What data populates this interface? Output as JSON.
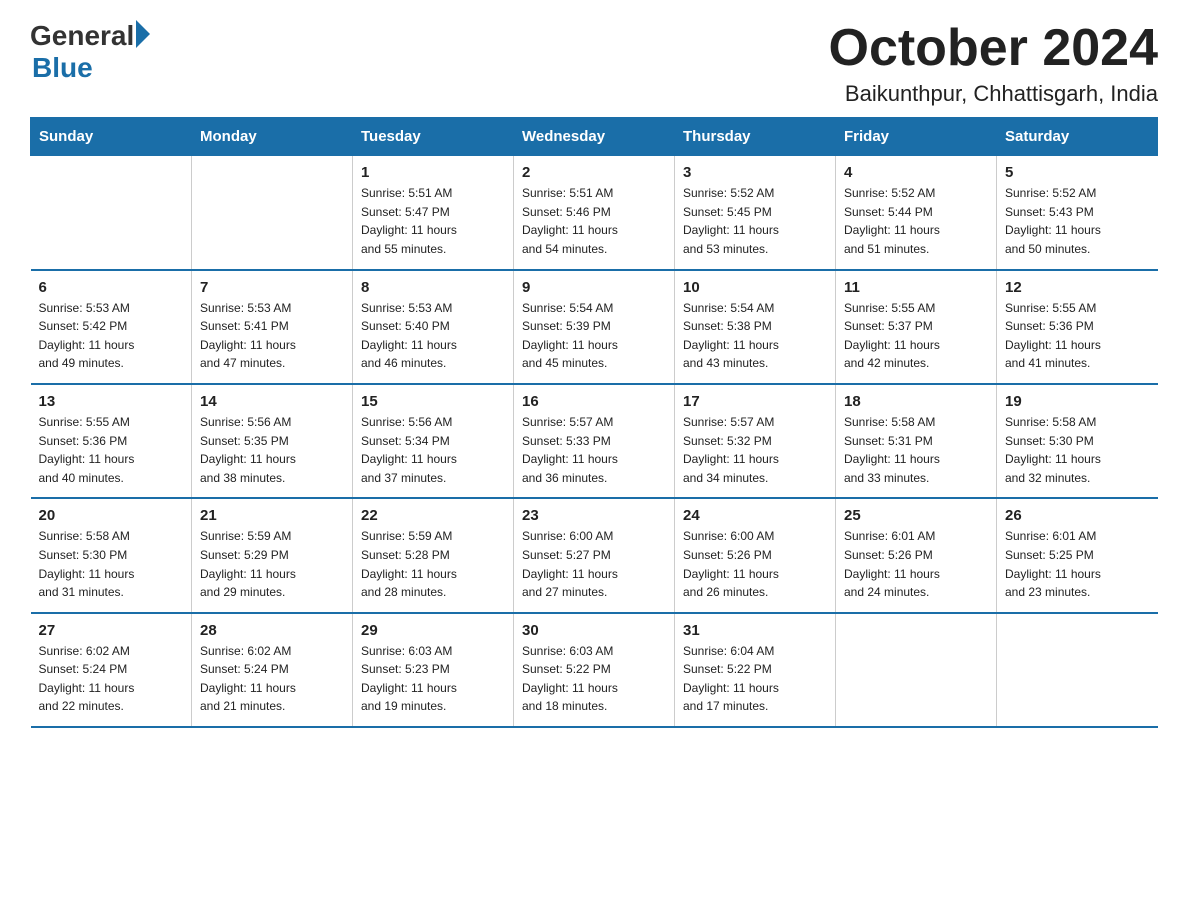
{
  "header": {
    "logo_general": "General",
    "logo_blue": "Blue",
    "title": "October 2024",
    "location": "Baikunthpur, Chhattisgarh, India"
  },
  "days_of_week": [
    "Sunday",
    "Monday",
    "Tuesday",
    "Wednesday",
    "Thursday",
    "Friday",
    "Saturday"
  ],
  "weeks": [
    [
      {
        "day": "",
        "info": ""
      },
      {
        "day": "",
        "info": ""
      },
      {
        "day": "1",
        "info": "Sunrise: 5:51 AM\nSunset: 5:47 PM\nDaylight: 11 hours\nand 55 minutes."
      },
      {
        "day": "2",
        "info": "Sunrise: 5:51 AM\nSunset: 5:46 PM\nDaylight: 11 hours\nand 54 minutes."
      },
      {
        "day": "3",
        "info": "Sunrise: 5:52 AM\nSunset: 5:45 PM\nDaylight: 11 hours\nand 53 minutes."
      },
      {
        "day": "4",
        "info": "Sunrise: 5:52 AM\nSunset: 5:44 PM\nDaylight: 11 hours\nand 51 minutes."
      },
      {
        "day": "5",
        "info": "Sunrise: 5:52 AM\nSunset: 5:43 PM\nDaylight: 11 hours\nand 50 minutes."
      }
    ],
    [
      {
        "day": "6",
        "info": "Sunrise: 5:53 AM\nSunset: 5:42 PM\nDaylight: 11 hours\nand 49 minutes."
      },
      {
        "day": "7",
        "info": "Sunrise: 5:53 AM\nSunset: 5:41 PM\nDaylight: 11 hours\nand 47 minutes."
      },
      {
        "day": "8",
        "info": "Sunrise: 5:53 AM\nSunset: 5:40 PM\nDaylight: 11 hours\nand 46 minutes."
      },
      {
        "day": "9",
        "info": "Sunrise: 5:54 AM\nSunset: 5:39 PM\nDaylight: 11 hours\nand 45 minutes."
      },
      {
        "day": "10",
        "info": "Sunrise: 5:54 AM\nSunset: 5:38 PM\nDaylight: 11 hours\nand 43 minutes."
      },
      {
        "day": "11",
        "info": "Sunrise: 5:55 AM\nSunset: 5:37 PM\nDaylight: 11 hours\nand 42 minutes."
      },
      {
        "day": "12",
        "info": "Sunrise: 5:55 AM\nSunset: 5:36 PM\nDaylight: 11 hours\nand 41 minutes."
      }
    ],
    [
      {
        "day": "13",
        "info": "Sunrise: 5:55 AM\nSunset: 5:36 PM\nDaylight: 11 hours\nand 40 minutes."
      },
      {
        "day": "14",
        "info": "Sunrise: 5:56 AM\nSunset: 5:35 PM\nDaylight: 11 hours\nand 38 minutes."
      },
      {
        "day": "15",
        "info": "Sunrise: 5:56 AM\nSunset: 5:34 PM\nDaylight: 11 hours\nand 37 minutes."
      },
      {
        "day": "16",
        "info": "Sunrise: 5:57 AM\nSunset: 5:33 PM\nDaylight: 11 hours\nand 36 minutes."
      },
      {
        "day": "17",
        "info": "Sunrise: 5:57 AM\nSunset: 5:32 PM\nDaylight: 11 hours\nand 34 minutes."
      },
      {
        "day": "18",
        "info": "Sunrise: 5:58 AM\nSunset: 5:31 PM\nDaylight: 11 hours\nand 33 minutes."
      },
      {
        "day": "19",
        "info": "Sunrise: 5:58 AM\nSunset: 5:30 PM\nDaylight: 11 hours\nand 32 minutes."
      }
    ],
    [
      {
        "day": "20",
        "info": "Sunrise: 5:58 AM\nSunset: 5:30 PM\nDaylight: 11 hours\nand 31 minutes."
      },
      {
        "day": "21",
        "info": "Sunrise: 5:59 AM\nSunset: 5:29 PM\nDaylight: 11 hours\nand 29 minutes."
      },
      {
        "day": "22",
        "info": "Sunrise: 5:59 AM\nSunset: 5:28 PM\nDaylight: 11 hours\nand 28 minutes."
      },
      {
        "day": "23",
        "info": "Sunrise: 6:00 AM\nSunset: 5:27 PM\nDaylight: 11 hours\nand 27 minutes."
      },
      {
        "day": "24",
        "info": "Sunrise: 6:00 AM\nSunset: 5:26 PM\nDaylight: 11 hours\nand 26 minutes."
      },
      {
        "day": "25",
        "info": "Sunrise: 6:01 AM\nSunset: 5:26 PM\nDaylight: 11 hours\nand 24 minutes."
      },
      {
        "day": "26",
        "info": "Sunrise: 6:01 AM\nSunset: 5:25 PM\nDaylight: 11 hours\nand 23 minutes."
      }
    ],
    [
      {
        "day": "27",
        "info": "Sunrise: 6:02 AM\nSunset: 5:24 PM\nDaylight: 11 hours\nand 22 minutes."
      },
      {
        "day": "28",
        "info": "Sunrise: 6:02 AM\nSunset: 5:24 PM\nDaylight: 11 hours\nand 21 minutes."
      },
      {
        "day": "29",
        "info": "Sunrise: 6:03 AM\nSunset: 5:23 PM\nDaylight: 11 hours\nand 19 minutes."
      },
      {
        "day": "30",
        "info": "Sunrise: 6:03 AM\nSunset: 5:22 PM\nDaylight: 11 hours\nand 18 minutes."
      },
      {
        "day": "31",
        "info": "Sunrise: 6:04 AM\nSunset: 5:22 PM\nDaylight: 11 hours\nand 17 minutes."
      },
      {
        "day": "",
        "info": ""
      },
      {
        "day": "",
        "info": ""
      }
    ]
  ]
}
